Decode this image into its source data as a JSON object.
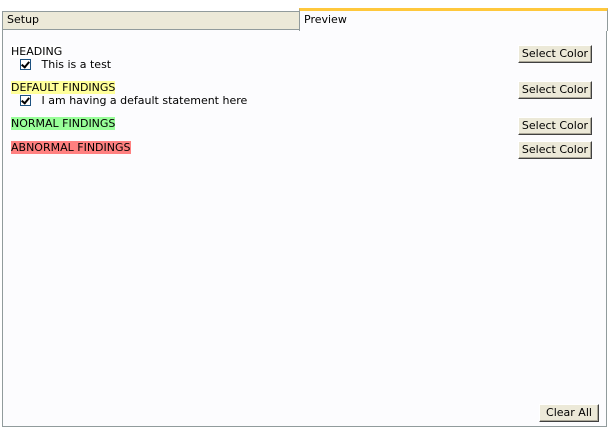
{
  "tabs": {
    "setup_label": "Setup",
    "preview_label": "Preview"
  },
  "sections": [
    {
      "label": "HEADING",
      "highlight": "#ffffff",
      "button_label": "Select Color",
      "item": {
        "checked": true,
        "label": "This is a test"
      }
    },
    {
      "label": "DEFAULT FINDINGS",
      "highlight": "#ffff99",
      "button_label": "Select Color",
      "item": {
        "checked": true,
        "label": "I am having a default statement here"
      }
    },
    {
      "label": "NORMAL FINDINGS",
      "highlight": "#99ff99",
      "button_label": "Select Color",
      "item": null
    },
    {
      "label": "ABNORMAL FINDINGS",
      "highlight": "#ff8080",
      "button_label": "Select Color",
      "item": null
    }
  ],
  "footer": {
    "clear_all_label": "Clear All"
  },
  "colors": {
    "active_tab_accent": "#ffc83c",
    "tab_border": "#919b9c",
    "button_face": "#ece9d8"
  }
}
